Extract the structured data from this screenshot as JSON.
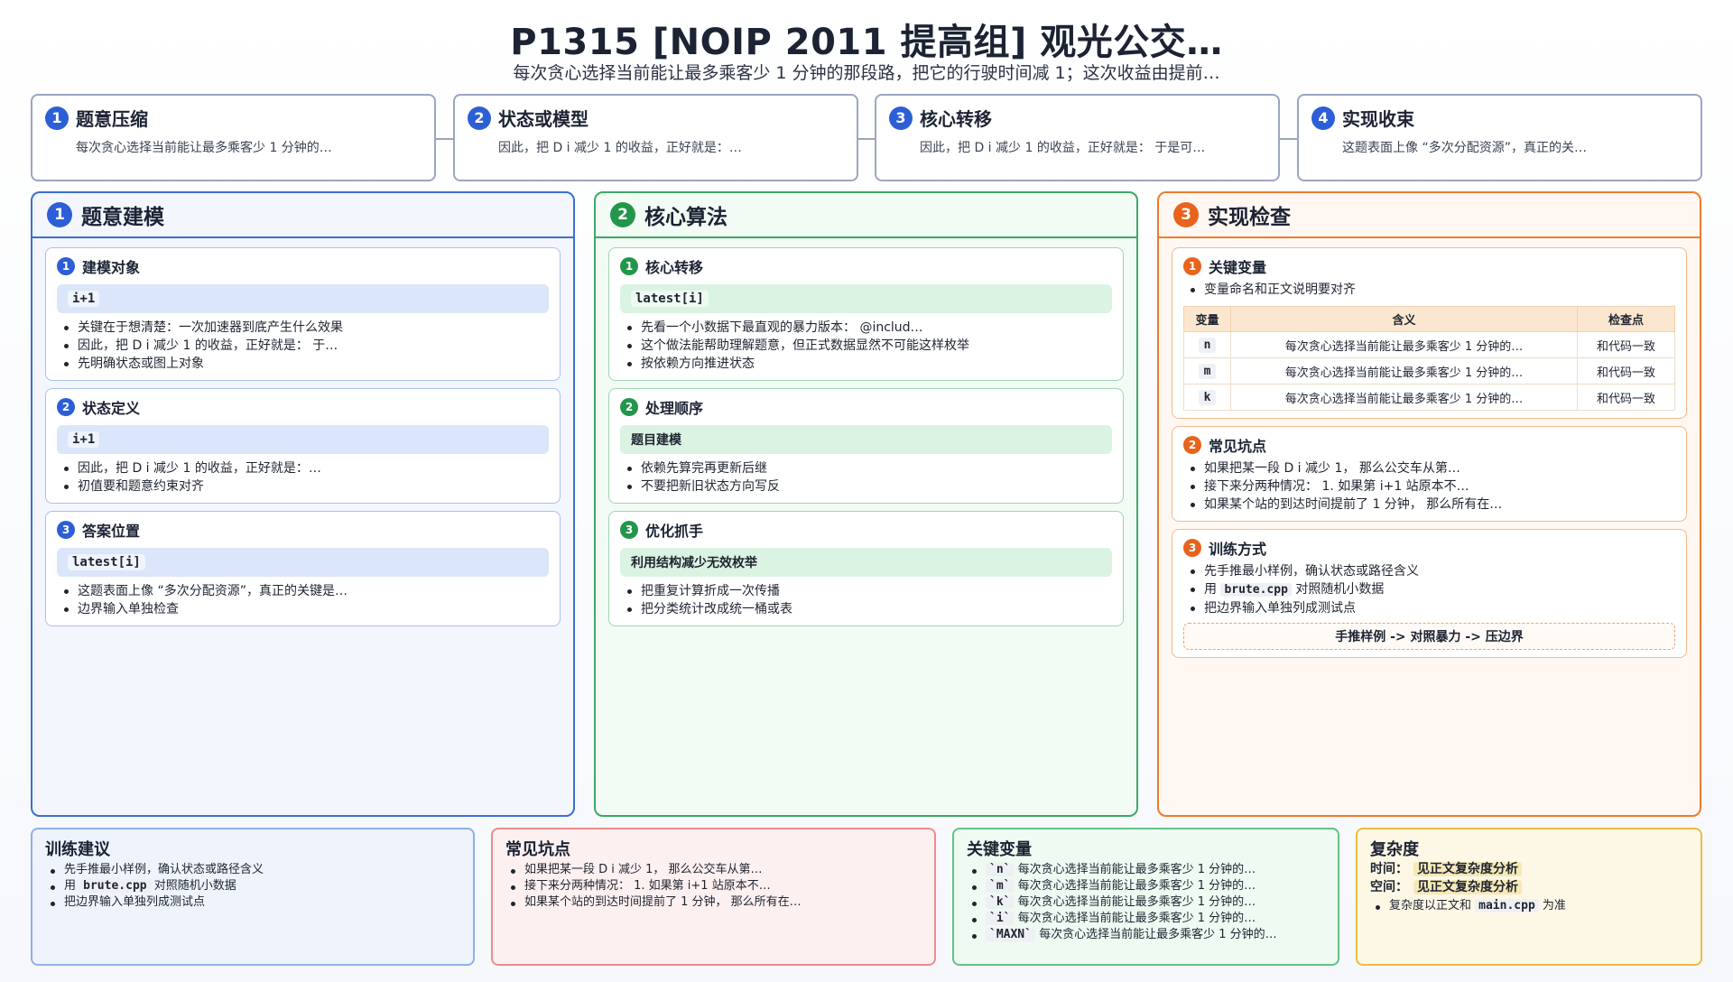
{
  "header": {
    "title": "P1315 [NOIP 2011 提高组] 观光公交…",
    "subtitle": "每次贪心选择当前能让最多乘客少 1 分钟的那段路，把它的行驶时间减 1；这次收益由提前…"
  },
  "steps": [
    {
      "num": "1",
      "title": "题意压缩",
      "text": "每次贪心选择当前能让最多乘客少 1 分钟的…"
    },
    {
      "num": "2",
      "title": "状态或模型",
      "text": "因此，把 D i 减少 1 的收益，正好就是：…"
    },
    {
      "num": "3",
      "title": "核心转移",
      "text": "因此，把 D i 减少 1 的收益，正好就是： 于是可…"
    },
    {
      "num": "4",
      "title": "实现收束",
      "text": "这题表面上像 “多次分配资源”，真正的关…"
    }
  ],
  "panels": {
    "modeling": {
      "num": "1",
      "title": "题意建模",
      "cards": [
        {
          "num": "1",
          "title": "建模对象",
          "chip": "i+1",
          "bullets": [
            "关键在于想清楚：一次加速器到底产生什么效果",
            "因此，把 D i 减少 1 的收益，正好就是： 于…",
            "先明确状态或图上对象"
          ]
        },
        {
          "num": "2",
          "title": "状态定义",
          "chip": "i+1",
          "bullets": [
            "因此，把 D i 减少 1 的收益，正好就是：…",
            "初值要和题意约束对齐"
          ]
        },
        {
          "num": "3",
          "title": "答案位置",
          "chip": "latest[i]",
          "bullets": [
            "这题表面上像 “多次分配资源”，真正的关键是…",
            "边界输入单独检查"
          ]
        }
      ]
    },
    "algorithm": {
      "num": "2",
      "title": "核心算法",
      "cards": [
        {
          "num": "1",
          "title": "核心转移",
          "chip": "latest[i]",
          "bullets": [
            "先看一个小数据下最直观的暴力版本： @includ…",
            "这个做法能帮助理解题意，但正式数据显然不可能这样枚举",
            "按依赖方向推进状态"
          ]
        },
        {
          "num": "2",
          "title": "处理顺序",
          "chip": "题目建模",
          "bullets": [
            "依赖先算完再更新后继",
            "不要把新旧状态方向写反"
          ]
        },
        {
          "num": "3",
          "title": "优化抓手",
          "chip": "利用结构减少无效枚举",
          "bullets": [
            "把重复计算折成一次传播",
            "把分类统计改成统一桶或表"
          ]
        }
      ]
    },
    "impl": {
      "num": "3",
      "title": "实现检查",
      "vars": {
        "num": "1",
        "title": "关键变量",
        "note": "变量命名和正文说明要对齐",
        "headers": [
          "变量",
          "含义",
          "检查点"
        ],
        "rows": [
          {
            "var": "n",
            "meaning": "每次贪心选择当前能让最多乘客少 1 分钟的…",
            "check": "和代码一致"
          },
          {
            "var": "m",
            "meaning": "每次贪心选择当前能让最多乘客少 1 分钟的…",
            "check": "和代码一致"
          },
          {
            "var": "k",
            "meaning": "每次贪心选择当前能让最多乘客少 1 分钟的…",
            "check": "和代码一致"
          }
        ]
      },
      "pitfalls": {
        "num": "2",
        "title": "常见坑点",
        "bullets": [
          "如果把某一段 D i 减少 1， 那么公交车从第…",
          "接下来分两种情况： 1. 如果第 i+1 站原本不…",
          "如果某个站的到达时间提前了 1 分钟， 那么所有在…"
        ]
      },
      "training": {
        "num": "3",
        "title": "训练方式",
        "b1": "先手推最小样例，确认状态或路径含义",
        "b2_pre": "用",
        "b2_code": "brute.cpp",
        "b2_post": "对照随机小数据",
        "b3": "把边界输入单独列成测试点",
        "flow": "手推样例 -> 对照暴力 -> 压边界"
      }
    }
  },
  "summary": {
    "training": {
      "title": "训练建议",
      "b1": "先手推最小样例，确认状态或路径含义",
      "b2_pre": "用",
      "b2_code": "brute.cpp",
      "b2_post": "对照随机小数据",
      "b3": "把边界输入单独列成测试点"
    },
    "pitfalls": {
      "title": "常见坑点",
      "bullets": [
        "如果把某一段 D i 减少 1， 那么公交车从第…",
        "接下来分两种情况： 1. 如果第 i+1 站原本不…",
        "如果某个站的到达时间提前了 1 分钟， 那么所有在…"
      ]
    },
    "vars": {
      "title": "关键变量",
      "items": [
        {
          "code": "`n`",
          "text": "每次贪心选择当前能让最多乘客少 1 分钟的…"
        },
        {
          "code": "`m`",
          "text": "每次贪心选择当前能让最多乘客少 1 分钟的…"
        },
        {
          "code": "`k`",
          "text": "每次贪心选择当前能让最多乘客少 1 分钟的…"
        },
        {
          "code": "`i`",
          "text": "每次贪心选择当前能让最多乘客少 1 分钟的…"
        },
        {
          "code": "`MAXN`",
          "text": "每次贪心选择当前能让最多乘客少 1 分钟的…"
        }
      ]
    },
    "complexity": {
      "title": "复杂度",
      "time_label": "时间：",
      "time_value": "见正文复杂度分析",
      "space_label": "空间：",
      "space_value": "见正文复杂度分析",
      "note_pre": "复杂度以正文和",
      "note_code": "main.cpp",
      "note_post": "为准"
    }
  }
}
